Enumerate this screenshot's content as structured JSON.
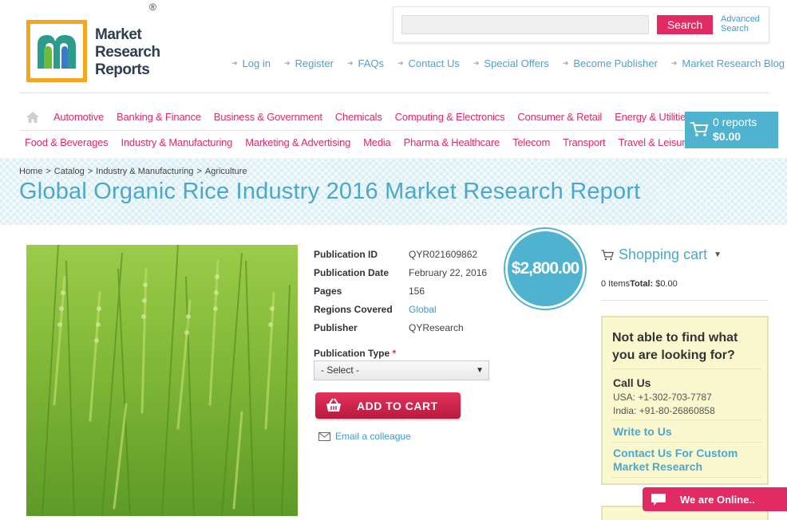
{
  "logo": {
    "line1": "Market",
    "line2": "Research",
    "line3": "Reports",
    "reg": "®"
  },
  "search": {
    "placeholder": "",
    "button": "Search",
    "advanced_line1": "Advanced",
    "advanced_line2": "Search"
  },
  "top_links": [
    "Log in",
    "Register",
    "FAQs",
    "Contact Us",
    "Special Offers",
    "Become Publisher",
    "Market Research Blog"
  ],
  "categories_row1": [
    "Automotive",
    "Banking & Finance",
    "Business & Government",
    "Chemicals",
    "Computing & Electronics",
    "Consumer & Retail",
    "Energy & Utilities"
  ],
  "categories_row2": [
    "Food & Beverages",
    "Industry & Manufacturing",
    "Marketing & Advertising",
    "Media",
    "Pharma & Healthcare",
    "Telecom",
    "Transport",
    "Travel & Leisure"
  ],
  "cart": {
    "count": "0 reports",
    "total": "$0.00"
  },
  "breadcrumb": [
    "Home",
    ">",
    "Catalog",
    ">",
    "Industry & Manufacturing",
    ">",
    "Agriculture"
  ],
  "title": "Global Organic Rice Industry 2016 Market Research Report",
  "details": [
    {
      "label": "Publication ID",
      "value": "QYR021609862"
    },
    {
      "label": "Publication Date",
      "value": "February 22, 2016"
    },
    {
      "label": "Pages",
      "value": "156"
    },
    {
      "label": "Regions Covered",
      "value": "Global"
    },
    {
      "label": "Publisher",
      "value": "QYResearch"
    }
  ],
  "publication_type": {
    "label": "Publication Type",
    "required": "*",
    "selected": "- Select -"
  },
  "add_to_cart": "ADD TO CART",
  "email_colleague": "Email a colleague",
  "price": "$2,800.00",
  "shopping_cart": {
    "title": "Shopping cart",
    "items_text": "0 Items",
    "total_label": "Total:",
    "total_value": "$0.00"
  },
  "help": {
    "question": "Not able to find what you are looking for?",
    "call_us": "Call Us",
    "usa": "USA: +1-302-703-7787",
    "india": "India: +91-80-26860858",
    "write_to_us": "Write to Us",
    "custom": "Contact Us For Custom Market Research"
  },
  "online": "We are Online..",
  "colors": {
    "accent_pink": "#e22b63",
    "accent_blue": "#4fb3cf",
    "title_blue": "#4ba8cd",
    "logo_orange": "#f6a521"
  }
}
